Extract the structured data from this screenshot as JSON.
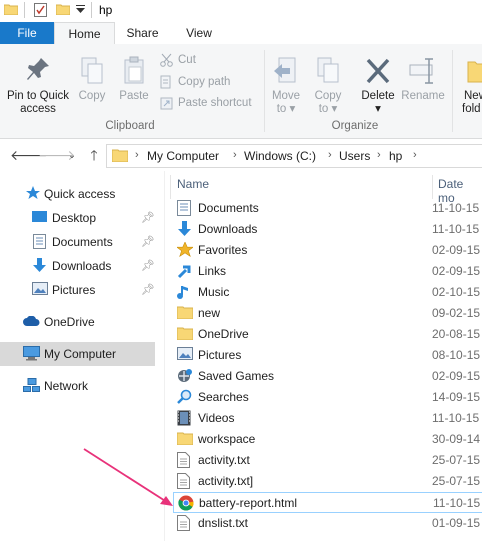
{
  "window": {
    "title": "hp"
  },
  "tabs": {
    "file": "File",
    "home": "Home",
    "share": "Share",
    "view": "View"
  },
  "ribbon": {
    "pin_label_line1": "Pin to Quick",
    "pin_label_line2": "access",
    "copy": "Copy",
    "paste": "Paste",
    "cut": "Cut",
    "copy_path": "Copy path",
    "paste_shortcut": "Paste shortcut",
    "clipboard_group": "Clipboard",
    "move_to_line1": "Move",
    "move_to_line2": "to",
    "copy_to_line1": "Copy",
    "copy_to_line2": "to",
    "delete": "Delete",
    "rename": "Rename",
    "organize_group": "Organize",
    "new_folder_partial_line1": "New",
    "new_folder_partial_line2": "fold"
  },
  "address": {
    "crumbs": [
      "My Computer",
      "Windows (C:)",
      "Users",
      "hp"
    ]
  },
  "nav": {
    "items": [
      {
        "label": "Quick access",
        "icon": "star-icon"
      },
      {
        "label": "Desktop",
        "icon": "desktop-icon",
        "pinned": true
      },
      {
        "label": "Documents",
        "icon": "documents-icon",
        "pinned": true
      },
      {
        "label": "Downloads",
        "icon": "downloads-icon",
        "pinned": true
      },
      {
        "label": "Pictures",
        "icon": "pictures-icon",
        "pinned": true
      },
      {
        "label": "OneDrive",
        "icon": "cloud-icon"
      },
      {
        "label": "My Computer",
        "icon": "computer-icon",
        "selected": true
      },
      {
        "label": "Network",
        "icon": "network-icon"
      }
    ]
  },
  "files": {
    "col_name": "Name",
    "col_date": "Date mo",
    "rows": [
      {
        "name": "Documents",
        "date": "11-10-15",
        "icon": "documents-folder-icon"
      },
      {
        "name": "Downloads",
        "date": "11-10-15",
        "icon": "downloads-folder-icon"
      },
      {
        "name": "Favorites",
        "date": "02-09-15",
        "icon": "favorites-folder-icon"
      },
      {
        "name": "Links",
        "date": "02-09-15",
        "icon": "links-folder-icon"
      },
      {
        "name": "Music",
        "date": "02-10-15",
        "icon": "music-folder-icon"
      },
      {
        "name": "new",
        "date": "09-02-15",
        "icon": "folder-icon"
      },
      {
        "name": "OneDrive",
        "date": "20-08-15",
        "icon": "folder-icon"
      },
      {
        "name": "Pictures",
        "date": "08-10-15",
        "icon": "pictures-folder-icon"
      },
      {
        "name": "Saved Games",
        "date": "02-09-15",
        "icon": "saved-games-folder-icon"
      },
      {
        "name": "Searches",
        "date": "14-09-15",
        "icon": "searches-folder-icon"
      },
      {
        "name": "Videos",
        "date": "11-10-15",
        "icon": "videos-folder-icon"
      },
      {
        "name": "workspace",
        "date": "30-09-14",
        "icon": "folder-icon"
      },
      {
        "name": "activity.txt",
        "date": "25-07-15",
        "icon": "text-file-icon"
      },
      {
        "name": "activity.txt]",
        "date": "25-07-15",
        "icon": "text-file-icon"
      },
      {
        "name": "battery-report.html",
        "date": "11-10-15",
        "icon": "chrome-html-icon",
        "selected": true
      },
      {
        "name": "dnslist.txt",
        "date": "01-09-15",
        "icon": "text-file-icon"
      }
    ]
  },
  "colors": {
    "accent": "#1979ca",
    "annotation_arrow": "#e8327a",
    "selection_border": "#99d1ff"
  }
}
